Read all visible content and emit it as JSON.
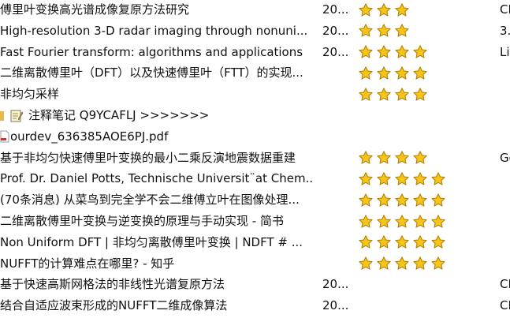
{
  "rows": [
    {
      "title": "傅里叶变换高光谱成像复原方法研究",
      "year": "20...",
      "stars": 3,
      "extra": "CN"
    },
    {
      "title": "High-resolution 3-D radar imaging through nonuni...",
      "year": "20...",
      "stars": 3,
      "extra": "3.7"
    },
    {
      "title": "Fast Fourier transform: algorithms and applications",
      "year": "20...",
      "stars": 4,
      "extra": "Lib"
    },
    {
      "title": "二维离散傅里叶（DFT）以及快速傅里叶（FTT）的实现...",
      "year": "",
      "stars": 4,
      "extra": ""
    },
    {
      "title": "非均匀采样",
      "year": "",
      "stars": 4,
      "extra": ""
    },
    {
      "title": "注释笔记 Q9YCAFLJ >>>>>>>",
      "year": "",
      "stars": 0,
      "extra": "",
      "icon": "note-icon",
      "prefix": "folder-edge-icon"
    },
    {
      "title": "ourdev_636385AOE6PJ.pdf",
      "year": "",
      "stars": 0,
      "extra": "",
      "icon": "pdf-icon"
    },
    {
      "title": "基于非均匀快速傅里叶变换的最小二乘反演地震数据重建",
      "year": "",
      "stars": 4,
      "extra": "Go"
    },
    {
      "title": "Prof. Dr. Daniel Potts, Technische Universit¨at Chem...",
      "year": "",
      "stars": 5,
      "extra": ""
    },
    {
      "title": "(70条消息) 从菜鸟到完全学不会二维傅立叶在图像处理...",
      "year": "",
      "stars": 5,
      "extra": ""
    },
    {
      "title": "二维离散傅里叶变换与逆变换的原理与手动实现 - 简书",
      "year": "",
      "stars": 5,
      "extra": ""
    },
    {
      "title": "Non Uniform DFT | 非均匀离散傅里叶变换 | NDFT # ...",
      "year": "",
      "stars": 5,
      "extra": ""
    },
    {
      "title": "NUFFT的计算难点在哪里? - 知乎",
      "year": "",
      "stars": 5,
      "extra": ""
    },
    {
      "title": "基于快速高斯网格法的非线性光谱复原方法",
      "year": "20...",
      "stars": 0,
      "extra": "CN"
    },
    {
      "title": "结合自适应波束形成的NUFFT二维成像算法",
      "year": "20...",
      "stars": 0,
      "extra": "CN"
    }
  ],
  "colors": {
    "star_fill": "#f5c518",
    "star_stroke": "#b07a00"
  }
}
